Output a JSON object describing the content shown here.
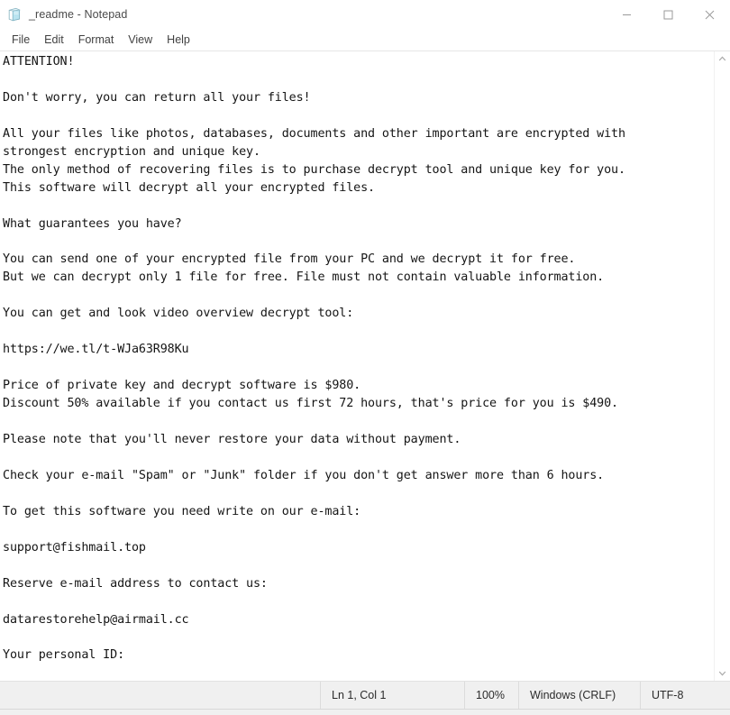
{
  "window": {
    "title": "_readme - Notepad",
    "icon": "notepad-icon",
    "controls": {
      "minimize_label": "─",
      "maximize_label": "□",
      "close_label": "✕"
    }
  },
  "menubar": {
    "items": [
      {
        "label": "File"
      },
      {
        "label": "Edit"
      },
      {
        "label": "Format"
      },
      {
        "label": "View"
      },
      {
        "label": "Help"
      }
    ]
  },
  "document": {
    "filename": "_readme",
    "body": "ATTENTION!\n\nDon't worry, you can return all your files!\n\nAll your files like photos, databases, documents and other important are encrypted with\nstrongest encryption and unique key.\nThe only method of recovering files is to purchase decrypt tool and unique key for you.\nThis software will decrypt all your encrypted files.\n\nWhat guarantees you have?\n\nYou can send one of your encrypted file from your PC and we decrypt it for free.\nBut we can decrypt only 1 file for free. File must not contain valuable information.\n\nYou can get and look video overview decrypt tool:\n\nhttps://we.tl/t-WJa63R98Ku\n\nPrice of private key and decrypt software is $980.\nDiscount 50% available if you contact us first 72 hours, that's price for you is $490.\n\nPlease note that you'll never restore your data without payment.\n\nCheck your e-mail \"Spam\" or \"Junk\" folder if you don't get answer more than 6 hours.\n\nTo get this software you need write on our e-mail:\n\nsupport@fishmail.top\n\nReserve e-mail address to contact us:\n\ndatarestorehelp@airmail.cc\n\nYour personal ID:",
    "lines": [
      "ATTENTION!",
      "",
      "Don't worry, you can return all your files!",
      "",
      "All your files like photos, databases, documents and other important are encrypted with",
      "strongest encryption and unique key.",
      "The only method of recovering files is to purchase decrypt tool and unique key for you.",
      "This software will decrypt all your encrypted files.",
      "",
      "What guarantees you have?",
      "",
      "You can send one of your encrypted file from your PC and we decrypt it for free.",
      "But we can decrypt only 1 file for free. File must not contain valuable information.",
      "",
      "You can get and look video overview decrypt tool:",
      "",
      "https://we.tl/t-WJa63R98Ku",
      "",
      "Price of private key and decrypt software is $980.",
      "Discount 50% available if you contact us first 72 hours, that's price for you is $490.",
      "",
      "Please note that you'll never restore your data without payment.",
      "",
      "Check your e-mail \"Spam\" or \"Junk\" folder if you don't get answer more than 6 hours.",
      "",
      "To get this software you need write on our e-mail:",
      "",
      "support@fishmail.top",
      "",
      "Reserve e-mail address to contact us:",
      "",
      "datarestorehelp@airmail.cc",
      "",
      "Your personal ID:"
    ],
    "download_url": "https://we.tl/t-WJa63R98Ku",
    "primary_email": "support@fishmail.top",
    "reserve_email": "datarestorehelp@airmail.cc",
    "full_price": "$980",
    "discount_price": "$490",
    "discount_percent": "50%",
    "discount_window_hours": "72",
    "response_time_hours": "6"
  },
  "scrollbar": {
    "up_arrow": "∧",
    "down_arrow": "∨"
  },
  "statusbar": {
    "cursor_position": "Ln 1, Col 1",
    "zoom": "100%",
    "line_ending": "Windows (CRLF)",
    "encoding": "UTF-8"
  },
  "colors": {
    "window_bg": "#ffffff",
    "statusbar_bg": "#f0f0f0",
    "text": "#151515",
    "title_text": "#4a4a4a",
    "icon_blue": "#9ad7e8"
  }
}
